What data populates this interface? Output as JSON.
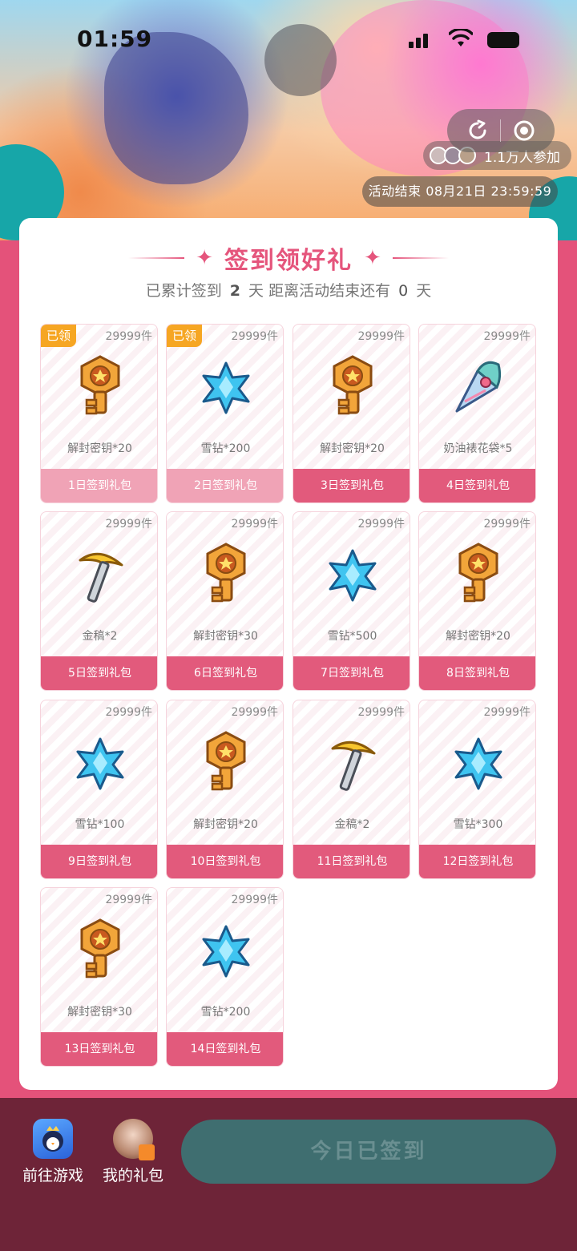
{
  "status": {
    "time": "01:59"
  },
  "banner": {
    "participants": "1.1万人参加",
    "end_time": "活动结束 08月21日 23:59:59"
  },
  "card": {
    "title": "签到领好礼",
    "subtitle_prefix": "已累计签到",
    "days_signed": "2",
    "subtitle_mid": "天 距离活动结束还有",
    "days_left": "0",
    "subtitle_suffix": "天"
  },
  "rewards": [
    {
      "stock": "29999件",
      "name": "解封密钥*20",
      "label": "1日签到礼包",
      "claimed": "已领",
      "icon": "key-icon"
    },
    {
      "stock": "29999件",
      "name": "雪钻*200",
      "label": "2日签到礼包",
      "claimed": "已领",
      "icon": "snow-diamond-icon"
    },
    {
      "stock": "29999件",
      "name": "解封密钥*20",
      "label": "3日签到礼包",
      "icon": "key-icon"
    },
    {
      "stock": "29999件",
      "name": "奶油裱花袋*5",
      "label": "4日签到礼包",
      "icon": "piping-bag-icon"
    },
    {
      "stock": "29999件",
      "name": "金稿*2",
      "label": "5日签到礼包",
      "icon": "pickaxe-icon"
    },
    {
      "stock": "29999件",
      "name": "解封密钥*30",
      "label": "6日签到礼包",
      "icon": "key-icon"
    },
    {
      "stock": "29999件",
      "name": "雪钻*500",
      "label": "7日签到礼包",
      "icon": "snow-diamond-icon"
    },
    {
      "stock": "29999件",
      "name": "解封密钥*20",
      "label": "8日签到礼包",
      "icon": "key-icon"
    },
    {
      "stock": "29999件",
      "name": "雪钻*100",
      "label": "9日签到礼包",
      "icon": "snow-diamond-icon"
    },
    {
      "stock": "29999件",
      "name": "解封密钥*20",
      "label": "10日签到礼包",
      "icon": "key-icon"
    },
    {
      "stock": "29999件",
      "name": "金稿*2",
      "label": "11日签到礼包",
      "icon": "pickaxe-icon"
    },
    {
      "stock": "29999件",
      "name": "雪钻*300",
      "label": "12日签到礼包",
      "icon": "snow-diamond-icon"
    },
    {
      "stock": "29999件",
      "name": "解封密钥*30",
      "label": "13日签到礼包",
      "icon": "key-icon"
    },
    {
      "stock": "29999件",
      "name": "雪钻*200",
      "label": "14日签到礼包",
      "icon": "snow-diamond-icon"
    }
  ],
  "bottom": {
    "go_game": "前往游戏",
    "my_gifts": "我的礼包",
    "signed_button": "今日已签到"
  },
  "colors": {
    "accent": "#e25a7c",
    "claimed_badge": "#f6a623",
    "button": "#3f6e70",
    "bottom_bar": "#6e2438"
  }
}
